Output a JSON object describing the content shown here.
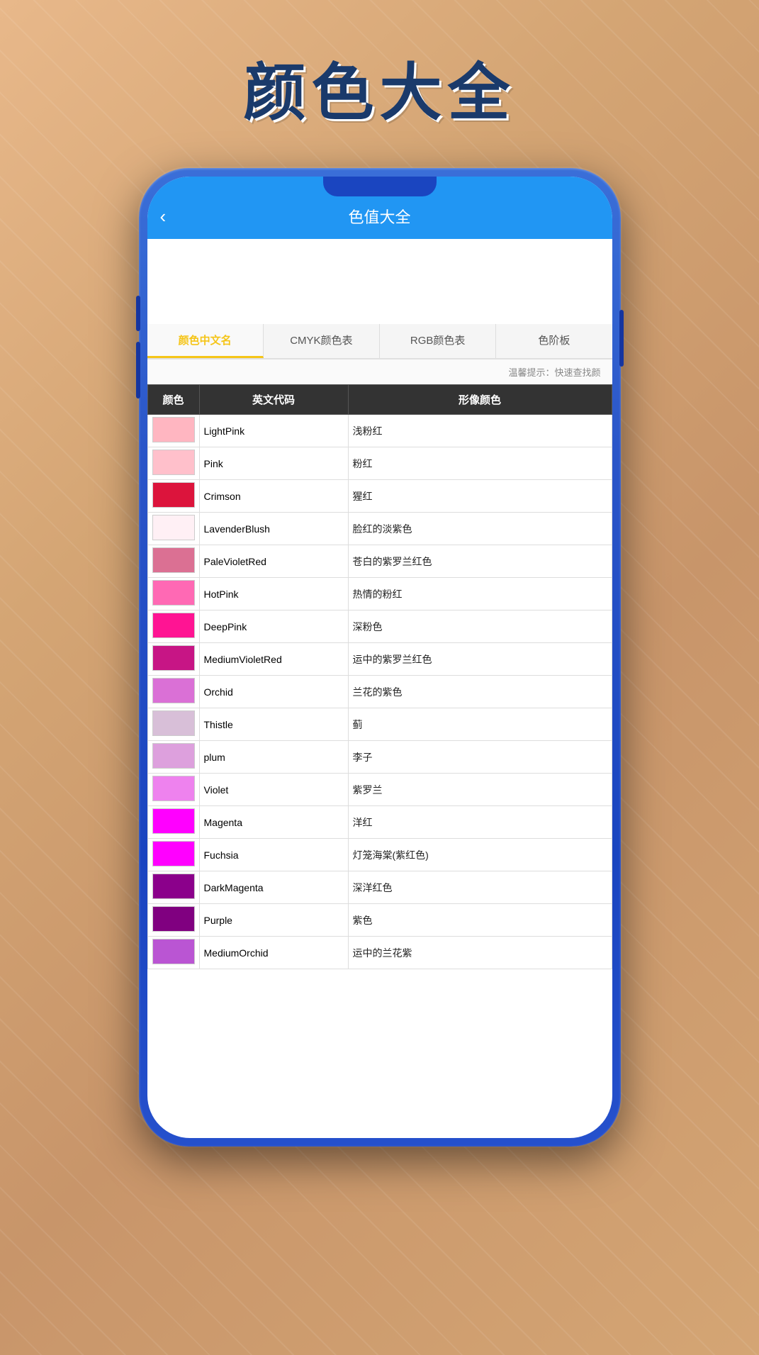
{
  "page": {
    "background_title": "颜色大全",
    "app_header": {
      "back_label": "‹",
      "title": "色值大全"
    },
    "tabs": [
      {
        "id": "chinese",
        "label": "颜色中文名",
        "active": true
      },
      {
        "id": "cmyk",
        "label": "CMYK颜色表",
        "active": false
      },
      {
        "id": "rgb",
        "label": "RGB颜色表",
        "active": false
      },
      {
        "id": "gradient",
        "label": "色阶板",
        "active": false
      }
    ],
    "hint": "温馨提示：快速查找颜",
    "table": {
      "headers": [
        "颜色",
        "英文代码",
        "形像颜色"
      ],
      "rows": [
        {
          "color": "#FFB6C1",
          "name_en": "LightPink",
          "name_cn": "浅粉红"
        },
        {
          "color": "#FFC0CB",
          "name_en": "Pink",
          "name_cn": "粉红"
        },
        {
          "color": "#DC143C",
          "name_en": "Crimson",
          "name_cn": "猩红"
        },
        {
          "color": "#FFF0F5",
          "name_en": "LavenderBlush",
          "name_cn": "脸红的淡紫色"
        },
        {
          "color": "#DB7093",
          "name_en": "PaleVioletRed",
          "name_cn": "苍白的紫罗兰红色"
        },
        {
          "color": "#FF69B4",
          "name_en": "HotPink",
          "name_cn": "热情的粉红"
        },
        {
          "color": "#FF1493",
          "name_en": "DeepPink",
          "name_cn": "深粉色"
        },
        {
          "color": "#C71585",
          "name_en": "MediumVioletRed",
          "name_cn": "运中的紫罗兰红色"
        },
        {
          "color": "#DA70D6",
          "name_en": "Orchid",
          "name_cn": "兰花的紫色"
        },
        {
          "color": "#D8BFD8",
          "name_en": "Thistle",
          "name_cn": "蓟"
        },
        {
          "color": "#DDA0DD",
          "name_en": "plum",
          "name_cn": "李子"
        },
        {
          "color": "#EE82EE",
          "name_en": "Violet",
          "name_cn": "紫罗兰"
        },
        {
          "color": "#FF00FF",
          "name_en": "Magenta",
          "name_cn": "洋红"
        },
        {
          "color": "#FF00FF",
          "name_en": "Fuchsia",
          "name_cn": "灯笼海棠(紫红色)"
        },
        {
          "color": "#8B008B",
          "name_en": "DarkMagenta",
          "name_cn": "深洋红色"
        },
        {
          "color": "#800080",
          "name_en": "Purple",
          "name_cn": "紫色"
        },
        {
          "color": "#BA55D3",
          "name_en": "MediumOrchid",
          "name_cn": "运中的兰花紫"
        }
      ]
    }
  }
}
